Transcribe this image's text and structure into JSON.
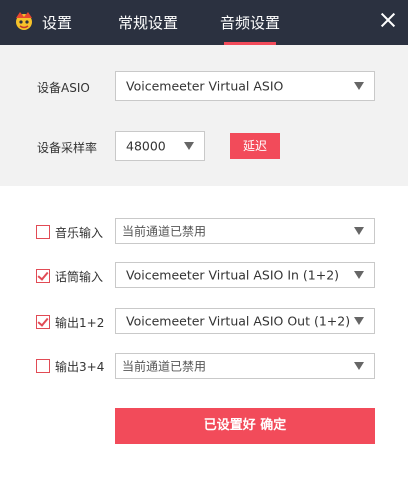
{
  "header": {
    "title": "设置",
    "tabs": [
      {
        "label": "常规设置"
      },
      {
        "label": "音频设置"
      }
    ]
  },
  "asio": {
    "label": "设备ASIO",
    "value": "Voicemeeter Virtual ASIO"
  },
  "samplerate": {
    "label": "设备采样率",
    "value": "48000",
    "delay_label": "延迟"
  },
  "channels": [
    {
      "label": "音乐输入",
      "checked": false,
      "value": "当前通道已禁用"
    },
    {
      "label": "话筒输入",
      "checked": true,
      "value": "Voicemeeter Virtual ASIO In (1+2)"
    },
    {
      "label": "输出1+2",
      "checked": true,
      "value": "Voicemeeter Virtual ASIO Out (1+2)"
    },
    {
      "label": "输出3+4",
      "checked": false,
      "value": "当前通道已禁用"
    }
  ],
  "confirm_label": "已设置好 确定",
  "colors": {
    "header_bg": "#2b3140",
    "accent": "#f24b5a",
    "section_bg": "#f2f2f2"
  }
}
